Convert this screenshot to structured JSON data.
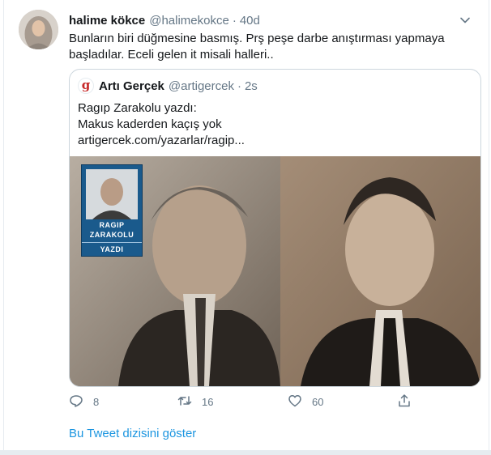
{
  "tweet": {
    "author_name": "halime kökce",
    "author_handle": "@halimekokce",
    "separator": "·",
    "time": "40d",
    "text_line1": "Bunların biri düğmesine basmış. Prş peşe darbe anıştırması yapmaya",
    "text_line2": "başladılar. Eceli gelen it misali halleri.."
  },
  "quoted": {
    "logo_glyph": "g",
    "name": "Artı Gerçek",
    "handle": "@artigercek",
    "separator": "·",
    "time": "2s",
    "line1": "Ragıp Zarakolu yazdı:",
    "line2": "Makus kaderden kaçış yok",
    "line3": "artigercek.com/yazarlar/ragip...",
    "badge": {
      "line1": "RAGIP",
      "line2": "ZARAKOLU",
      "line3": "YAZDI"
    }
  },
  "actions": {
    "reply_count": "8",
    "retweet_count": "16",
    "like_count": "60"
  },
  "show_thread_label": "Bu Tweet dizisini göster",
  "colors": {
    "link": "#1b95e0",
    "secondary_text": "#657786",
    "border": "#ccd6dd",
    "badge_blue": "#1a5a8c"
  },
  "icons": [
    "chevron-down-icon",
    "reply-icon",
    "retweet-icon",
    "like-icon",
    "share-icon"
  ]
}
